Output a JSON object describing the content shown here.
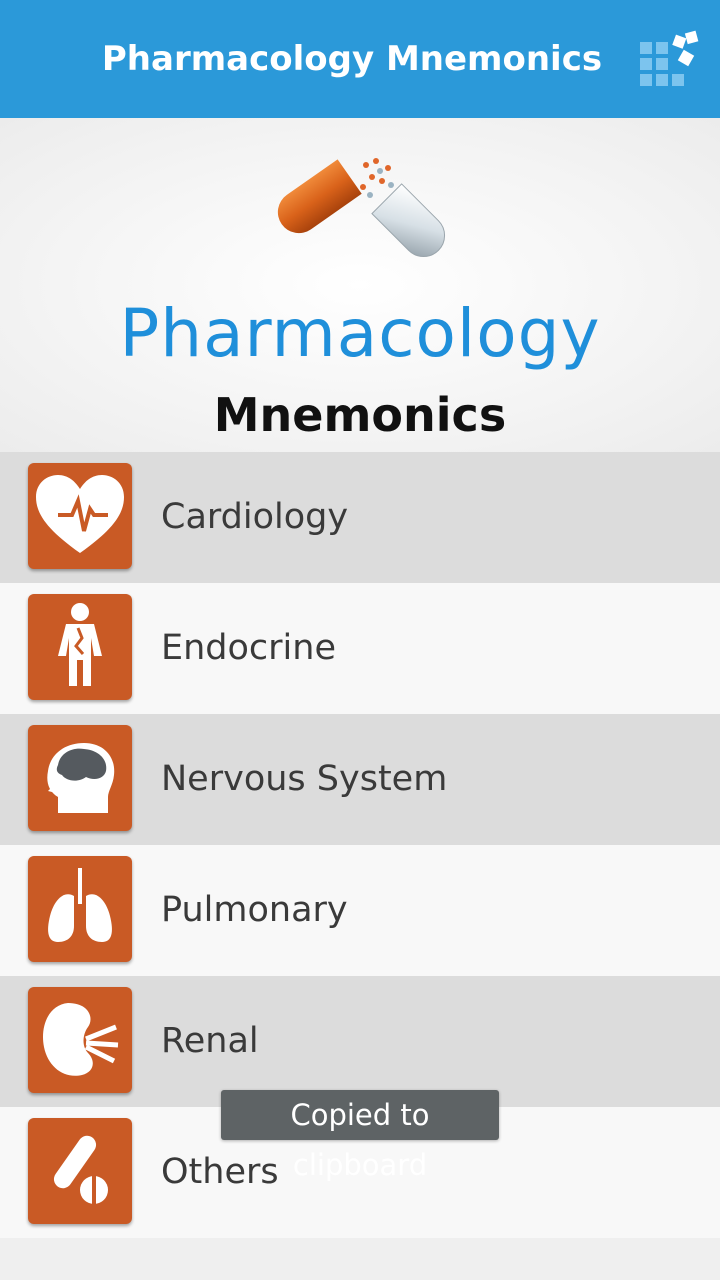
{
  "appbar": {
    "title": "Pharmacology Mnemonics",
    "action_icon": "grid-menu-icon",
    "color": "#2b99d9"
  },
  "hero": {
    "title": "Pharmacology",
    "subtitle": "Mnemonics",
    "logo_icon": "capsule-icon"
  },
  "categories": [
    {
      "label": "Cardiology",
      "icon": "heart-icon"
    },
    {
      "label": "Endocrine",
      "icon": "body-icon"
    },
    {
      "label": "Nervous System",
      "icon": "brain-head-icon"
    },
    {
      "label": "Pulmonary",
      "icon": "lungs-icon"
    },
    {
      "label": "Renal",
      "icon": "kidney-icon"
    },
    {
      "label": "Others",
      "icon": "pill-icon"
    }
  ],
  "toast": {
    "text": "Copied to clipboard"
  },
  "colors": {
    "tile": "#c95a25",
    "row_alt": "#dcdcdc",
    "row": "#f8f8f8"
  }
}
